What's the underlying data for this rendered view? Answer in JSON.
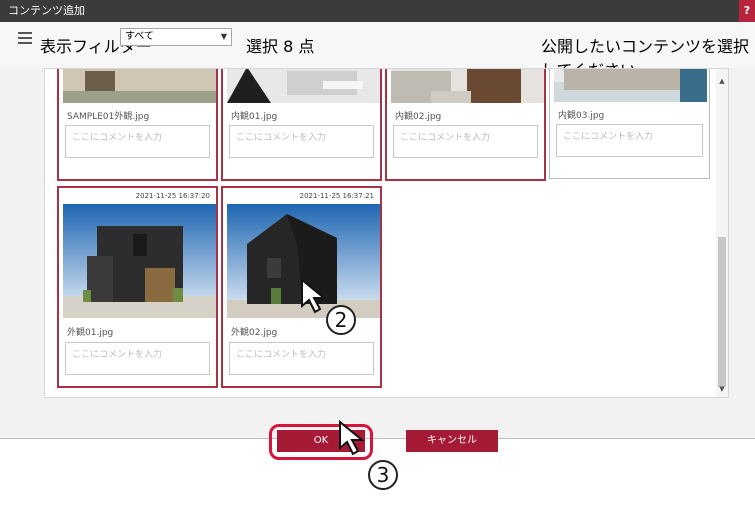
{
  "window": {
    "title": "コンテンツ追加",
    "help": "?"
  },
  "toolbar": {
    "filter_label": "表示フィルター",
    "filter_value": "すべて",
    "selected_count": "選択 8 点",
    "hint": "公開したいコンテンツを選択してください。"
  },
  "cards_top": [
    {
      "name": "SAMPLE01外観.jpg",
      "placeholder": "ここにコメントを入力",
      "selected": true
    },
    {
      "name": "内観01.jpg",
      "placeholder": "ここにコメントを入力",
      "selected": true
    },
    {
      "name": "内観02.jpg",
      "placeholder": "ここにコメントを入力",
      "selected": true
    },
    {
      "name": "内観03.jpg",
      "placeholder": "ここにコメントを入力",
      "selected": false
    }
  ],
  "cards_bottom": [
    {
      "timestamp": "2021-11-25 16:37:20",
      "name": "外観01.jpg",
      "placeholder": "ここにコメントを入力",
      "selected": true
    },
    {
      "timestamp": "2021-11-25 16:37:21",
      "name": "外観02.jpg",
      "placeholder": "ここにコメントを入力",
      "selected": true
    }
  ],
  "footer": {
    "ok": "OK",
    "cancel": "キャンセル"
  },
  "annotations": {
    "step2": "2",
    "step3": "3"
  },
  "colors": {
    "accent": "#a51b36",
    "titlebar": "#3b3b3b",
    "ring": "#d6153a"
  }
}
